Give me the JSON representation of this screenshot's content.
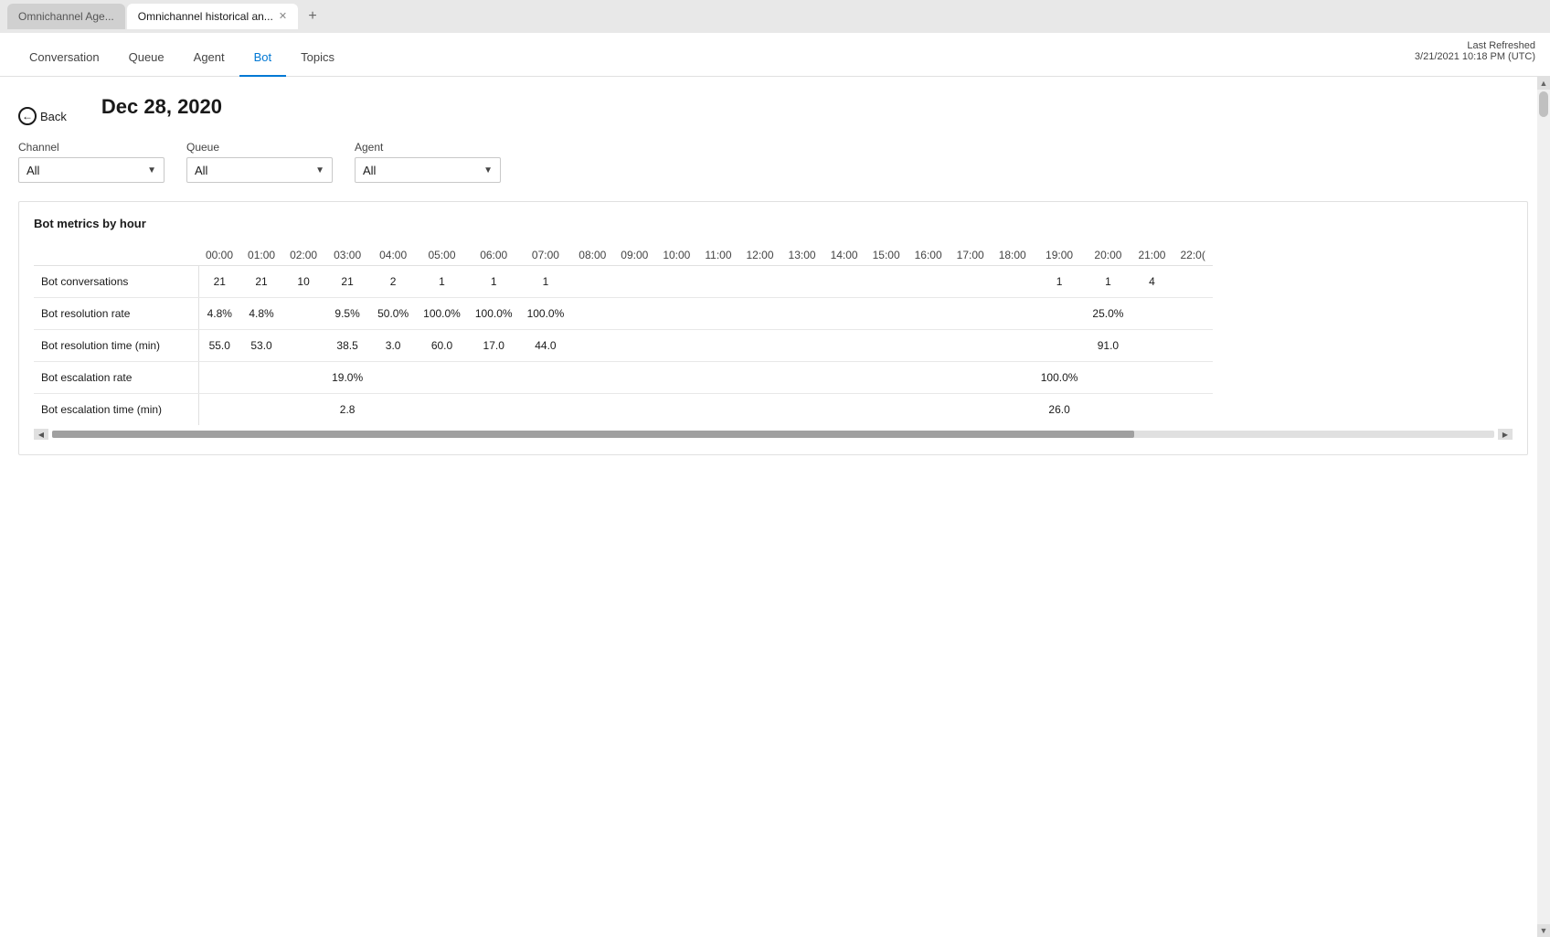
{
  "browser": {
    "tabs": [
      {
        "id": "tab1",
        "label": "Omnichannel Age...",
        "active": false
      },
      {
        "id": "tab2",
        "label": "Omnichannel historical an...",
        "active": true
      }
    ],
    "new_tab_label": "+"
  },
  "nav": {
    "tabs": [
      {
        "id": "conversation",
        "label": "Conversation",
        "active": false
      },
      {
        "id": "queue",
        "label": "Queue",
        "active": false
      },
      {
        "id": "agent",
        "label": "Agent",
        "active": false
      },
      {
        "id": "bot",
        "label": "Bot",
        "active": true
      },
      {
        "id": "topics",
        "label": "Topics",
        "active": false
      }
    ],
    "last_refreshed_label": "Last Refreshed",
    "last_refreshed_value": "3/21/2021 10:18 PM (UTC)"
  },
  "page": {
    "back_label": "Back",
    "date": "Dec 28, 2020",
    "filters": {
      "channel": {
        "label": "Channel",
        "value": "All"
      },
      "queue": {
        "label": "Queue",
        "value": "All"
      },
      "agent": {
        "label": "Agent",
        "value": "All"
      }
    },
    "metrics_card": {
      "title": "Bot metrics by hour",
      "hours": [
        "00:00",
        "01:00",
        "02:00",
        "03:00",
        "04:00",
        "05:00",
        "06:00",
        "07:00",
        "08:00",
        "09:00",
        "10:00",
        "11:00",
        "12:00",
        "13:00",
        "14:00",
        "15:00",
        "16:00",
        "17:00",
        "18:00",
        "19:00",
        "20:00",
        "21:00",
        "22:0("
      ],
      "rows": [
        {
          "label": "Bot conversations",
          "values": [
            "21",
            "21",
            "10",
            "21",
            "2",
            "1",
            "1",
            "1",
            "",
            "",
            "",
            "",
            "",
            "",
            "",
            "",
            "",
            "",
            "",
            "1",
            "1",
            "4",
            ""
          ]
        },
        {
          "label": "Bot resolution rate",
          "values": [
            "4.8%",
            "4.8%",
            "",
            "9.5%",
            "50.0%",
            "100.0%",
            "100.0%",
            "100.0%",
            "",
            "",
            "",
            "",
            "",
            "",
            "",
            "",
            "",
            "",
            "",
            "",
            "25.0%",
            "",
            ""
          ]
        },
        {
          "label": "Bot resolution time (min)",
          "values": [
            "55.0",
            "53.0",
            "",
            "38.5",
            "3.0",
            "60.0",
            "17.0",
            "44.0",
            "",
            "",
            "",
            "",
            "",
            "",
            "",
            "",
            "",
            "",
            "",
            "",
            "91.0",
            "",
            ""
          ]
        },
        {
          "label": "Bot escalation rate",
          "values": [
            "",
            "",
            "",
            "19.0%",
            "",
            "",
            "",
            "",
            "",
            "",
            "",
            "",
            "",
            "",
            "",
            "",
            "",
            "",
            "",
            "100.0%",
            "",
            "",
            ""
          ]
        },
        {
          "label": "Bot escalation time (min)",
          "values": [
            "",
            "",
            "",
            "2.8",
            "",
            "",
            "",
            "",
            "",
            "",
            "",
            "",
            "",
            "",
            "",
            "",
            "",
            "",
            "",
            "26.0",
            "",
            "",
            ""
          ]
        }
      ]
    }
  }
}
